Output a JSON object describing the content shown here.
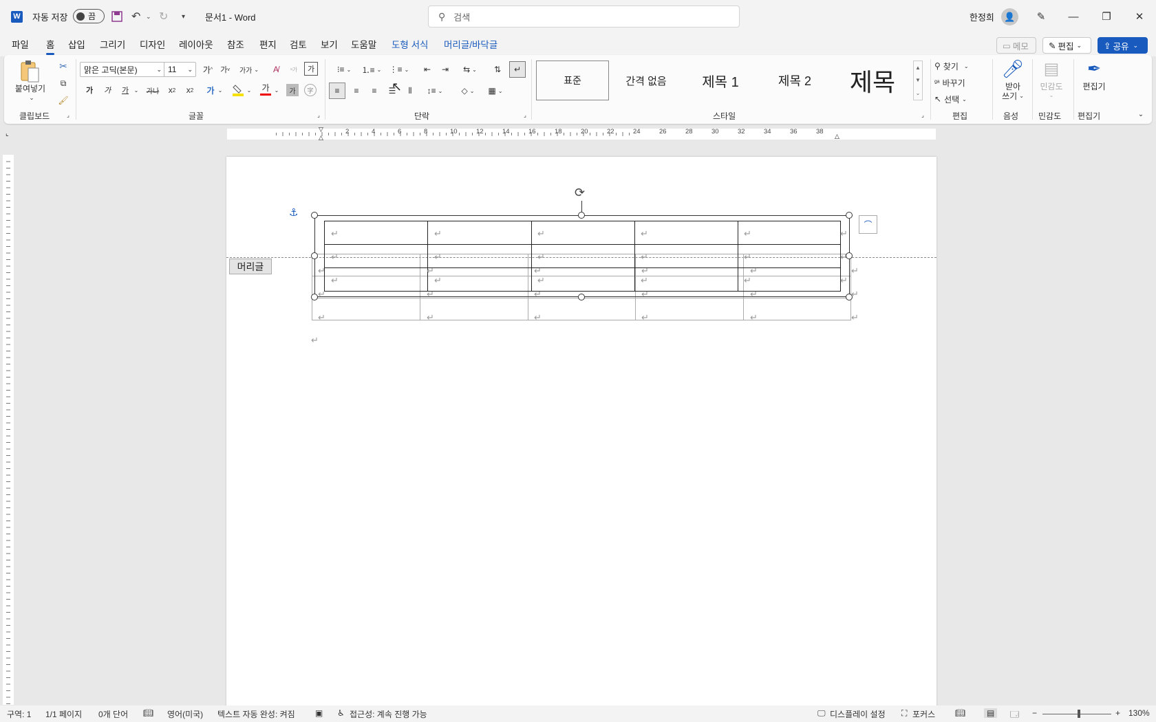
{
  "titlebar": {
    "autosave_label": "자동 저장",
    "autosave_state": "끔",
    "doc_title": "문서1  -  Word",
    "search_placeholder": "검색",
    "user_name": "한정희"
  },
  "tabs": {
    "file": "파일",
    "home": "홈",
    "insert": "삽입",
    "draw": "그리기",
    "design": "디자인",
    "layout": "레이아웃",
    "references": "참조",
    "mailings": "편지",
    "review": "검토",
    "view": "보기",
    "help": "도움말",
    "shape_format": "도형 서식",
    "header_footer": "머리글/바닥글",
    "memo": "메모",
    "editing": "편집",
    "share": "공유"
  },
  "ribbon": {
    "clipboard": {
      "paste": "붙여넣기",
      "label": "클립보드"
    },
    "font": {
      "label": "글꼴",
      "font_name": "맑은 고딕(본문)",
      "font_size": "11",
      "grow": "가",
      "shrink": "가",
      "case": "가가",
      "bold": "가",
      "italic": "가",
      "underline": "가",
      "strike": "가나",
      "color_letter": "가",
      "shade_letter": "가"
    },
    "paragraph": {
      "label": "단락"
    },
    "styles": {
      "label": "스타일",
      "items": [
        "표준",
        "간격 없음",
        "제목 1",
        "제목 2",
        "제목"
      ]
    },
    "editing": {
      "label": "편집",
      "find": "찾기",
      "replace": "바꾸기",
      "select": "선택"
    },
    "voice": {
      "label": "음성",
      "dictate_line1": "받아",
      "dictate_line2": "쓰기"
    },
    "sensitivity": {
      "label": "민감도",
      "button": "민감도"
    },
    "editor": {
      "label": "편집기",
      "button": "편집기"
    }
  },
  "ruler": {
    "ticks": [
      "2",
      "4",
      "6",
      "8",
      "10",
      "12",
      "14",
      "16",
      "18",
      "20",
      "22",
      "24",
      "26",
      "28",
      "30",
      "32",
      "34",
      "36",
      "38"
    ]
  },
  "document": {
    "header_tag": "머리글",
    "para_mark": "↵"
  },
  "statusbar": {
    "section": "구역: 1",
    "page": "1/1 페이지",
    "words": "0개 단어",
    "language": "영어(미국)",
    "autocomplete": "텍스트 자동 완성: 켜짐",
    "accessibility": "접근성: 계속 진행 가능",
    "display_settings": "디스플레이 설정",
    "focus": "포커스",
    "zoom": "130%"
  }
}
